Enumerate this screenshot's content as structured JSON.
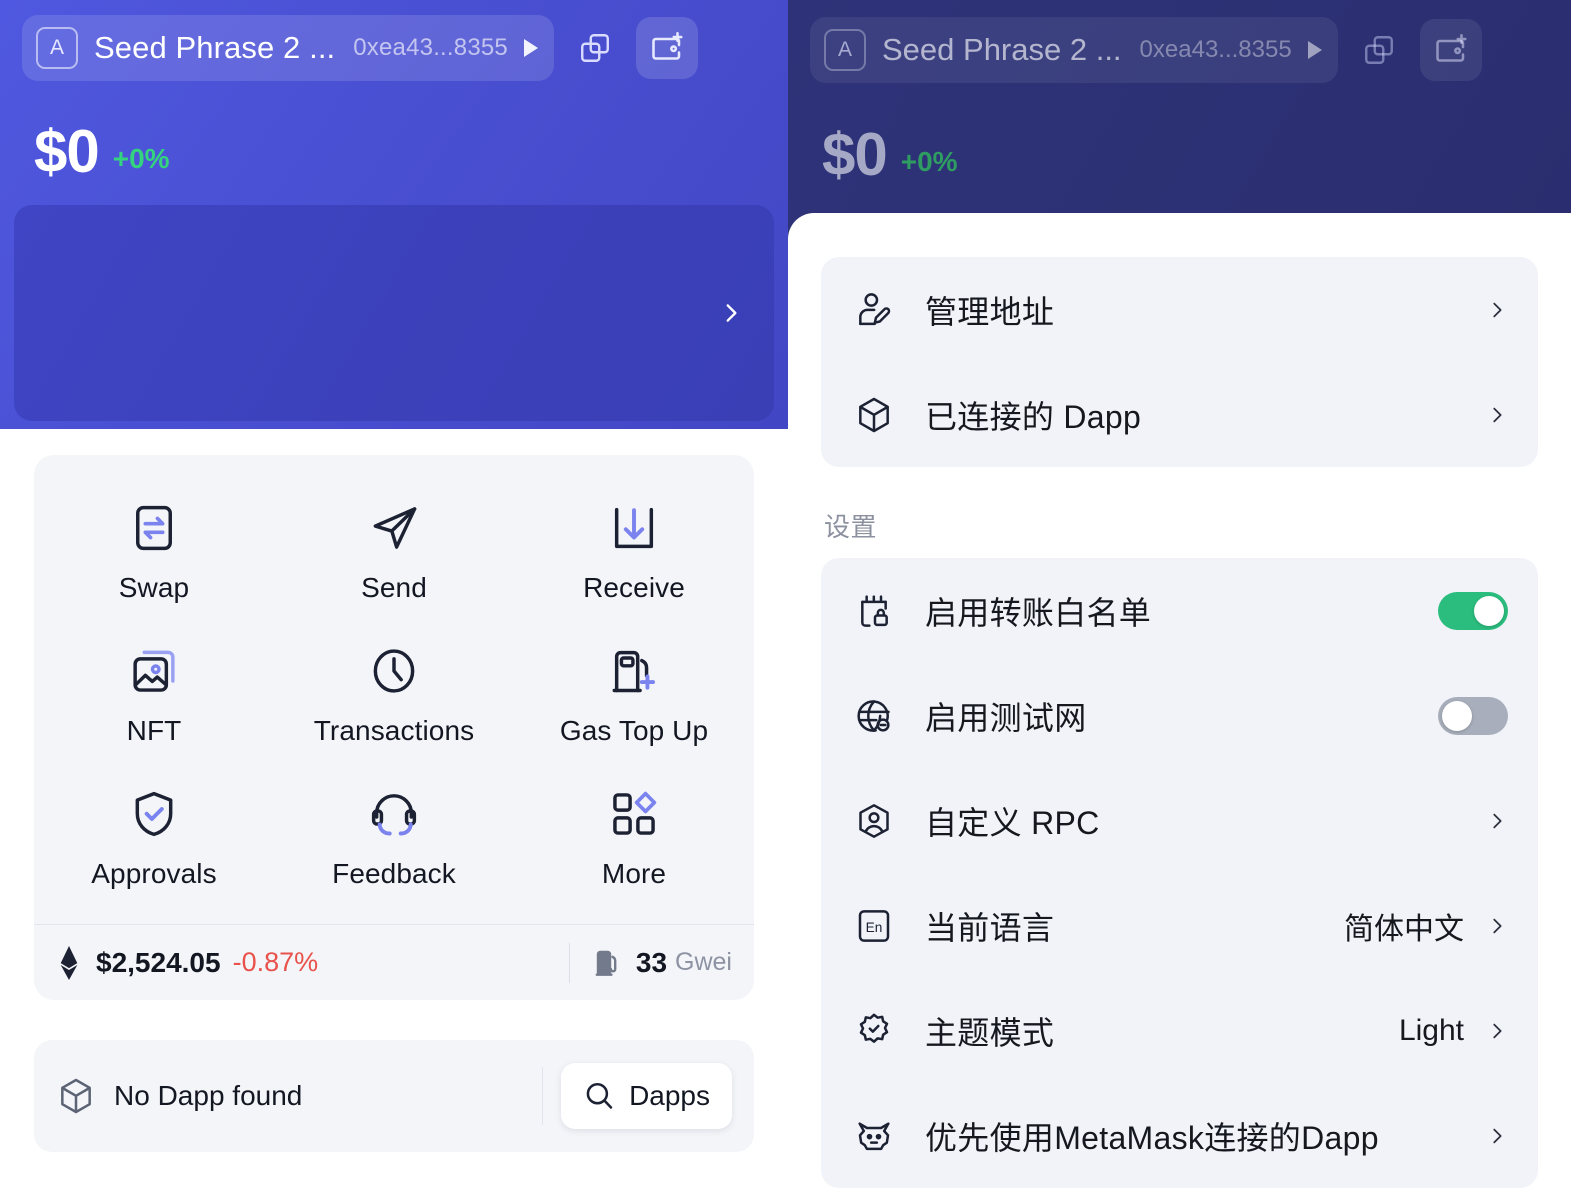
{
  "wallet": {
    "account_badge": "A",
    "account_name": "Seed Phrase 2 ...",
    "account_address": "0xea43...8355",
    "balance": "$0",
    "balance_change": "+0%",
    "copy_icon": "copy-icon",
    "add_wallet_icon": "add-wallet-icon",
    "caret_icon": "caret-right-icon",
    "banner_chevron_icon": "chevron-right-icon"
  },
  "actions": [
    {
      "label": "Swap",
      "icon": "swap-icon"
    },
    {
      "label": "Send",
      "icon": "send-icon"
    },
    {
      "label": "Receive",
      "icon": "receive-icon"
    },
    {
      "label": "NFT",
      "icon": "nft-image-icon"
    },
    {
      "label": "Transactions",
      "icon": "clock-icon"
    },
    {
      "label": "Gas Top Up",
      "icon": "gas-pump-plus-icon"
    },
    {
      "label": "Approvals",
      "icon": "shield-check-icon"
    },
    {
      "label": "Feedback",
      "icon": "headset-icon"
    },
    {
      "label": "More",
      "icon": "grid-more-icon"
    }
  ],
  "price_strip": {
    "eth_icon": "ethereum-icon",
    "eth_price": "$2,524.05",
    "eth_change": "-0.87%",
    "gas_icon": "gas-pump-icon",
    "gas_value": "33",
    "gas_unit": "Gwei"
  },
  "dapp_bar": {
    "cube_icon": "cube-icon",
    "status_text": "No Dapp found",
    "search_icon": "search-icon",
    "dapps_button": "Dapps"
  },
  "settings_panel": {
    "account_group": [
      {
        "label": "管理地址",
        "icon": "user-edit-icon",
        "control": "chevron"
      },
      {
        "label": "已连接的 Dapp",
        "icon": "cube-icon",
        "control": "chevron"
      }
    ],
    "section_title": "设置",
    "settings_group": [
      {
        "label": "启用转账白名单",
        "icon": "whitelist-lock-icon",
        "control": "toggle",
        "value": "on"
      },
      {
        "label": "启用测试网",
        "icon": "globe-icon",
        "control": "toggle",
        "value": "off"
      },
      {
        "label": "自定义 RPC",
        "icon": "rpc-node-icon",
        "control": "chevron"
      },
      {
        "label": "当前语言",
        "icon": "language-en-icon",
        "control": "chevron",
        "value": "简体中文"
      },
      {
        "label": "主题模式",
        "icon": "theme-badge-icon",
        "control": "chevron",
        "value": "Light"
      },
      {
        "label": "优先使用MetaMask连接的Dapp",
        "icon": "metamask-fox-icon",
        "control": "chevron"
      }
    ]
  },
  "colors": {
    "brand_purple": "#4b51d4",
    "dim_purple": "#2b2f71",
    "toggle_on_green": "#2bbd7e",
    "toggle_off_gray": "#a8aebb",
    "positive_green": "#34d37d",
    "negative_red": "#e8524b",
    "card_gray": "#f1f3f8"
  }
}
